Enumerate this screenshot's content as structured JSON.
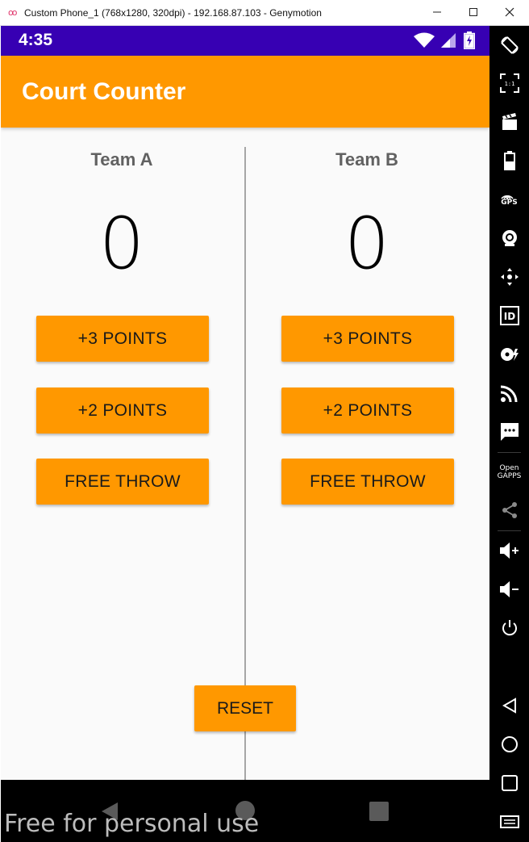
{
  "window": {
    "title": "Custom Phone_1 (768x1280, 320dpi) - 192.168.87.103 - Genymotion",
    "minimize_icon": "minimize-icon",
    "maximize_icon": "maximize-icon",
    "close_icon": "close-icon"
  },
  "status_bar": {
    "time": "4:35",
    "icons": [
      "wifi-icon",
      "signal-icon",
      "battery-charging-icon"
    ],
    "color": "#3700b3"
  },
  "app_bar": {
    "title": "Court Counter",
    "color": "#ff9800"
  },
  "team_a": {
    "name": "Team A",
    "score": "0",
    "buttons": [
      "+3 POINTS",
      "+2 POINTS",
      "FREE THROW"
    ]
  },
  "team_b": {
    "name": "Team B",
    "score": "0",
    "buttons": [
      "+3 POINTS",
      "+2 POINTS",
      "FREE THROW"
    ]
  },
  "reset_label": "RESET",
  "nav_bar": {
    "buttons": [
      "back-icon",
      "home-icon",
      "recents-icon"
    ]
  },
  "watermark": "Free for personal use",
  "toolbar": {
    "items": [
      "rotate-icon",
      "pixel-perfect-icon",
      "screencast-icon",
      "battery-icon",
      "gps-icon",
      "webcam-icon",
      "dpad-icon",
      "device-id-icon",
      "disk-io-icon",
      "network-icon",
      "sms-icon",
      "open-gapps-icon",
      "share-icon",
      "volume-up-icon",
      "volume-down-icon",
      "power-icon",
      "back-icon",
      "home-icon",
      "recents-icon",
      "menu-icon"
    ],
    "pixel_perfect_label": "1:1",
    "gps_label": "GPS",
    "id_label": "ID",
    "gapps_label_1": "Open",
    "gapps_label_2": "GAPPS"
  }
}
